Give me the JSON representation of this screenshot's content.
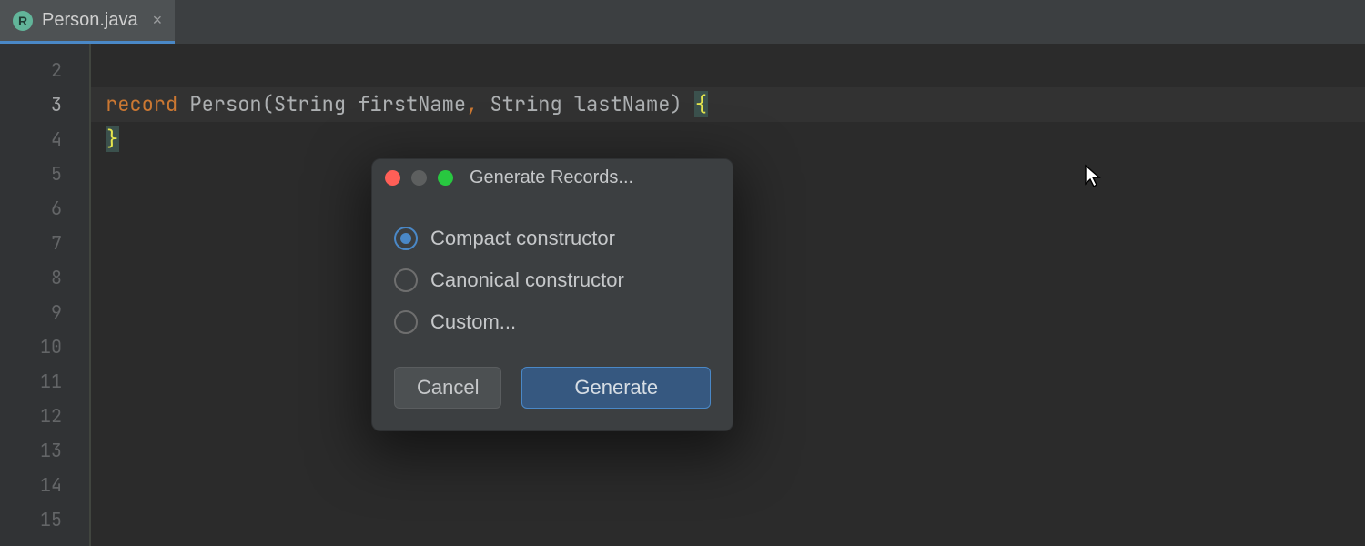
{
  "tab": {
    "icon_letter": "R",
    "filename": "Person.java",
    "close_glyph": "×"
  },
  "gutter": {
    "lines": [
      "2",
      "3",
      "4",
      "5",
      "6",
      "7",
      "8",
      "9",
      "10",
      "11",
      "12",
      "13",
      "14",
      "15"
    ],
    "active_index": 1
  },
  "code": {
    "line3": {
      "keyword": "record",
      "classname": "Person",
      "paren_open": "(",
      "type1": "String",
      "arg1": "firstName",
      "comma": ",",
      "type2": "String",
      "arg2": "lastName",
      "paren_close": ")",
      "brace_open": "{"
    },
    "line4": {
      "brace_close": "}"
    }
  },
  "dialog": {
    "title": "Generate Records...",
    "options": [
      {
        "label": "Compact constructor",
        "selected": true
      },
      {
        "label": "Canonical constructor",
        "selected": false
      },
      {
        "label": "Custom...",
        "selected": false
      }
    ],
    "cancel": "Cancel",
    "confirm": "Generate"
  }
}
